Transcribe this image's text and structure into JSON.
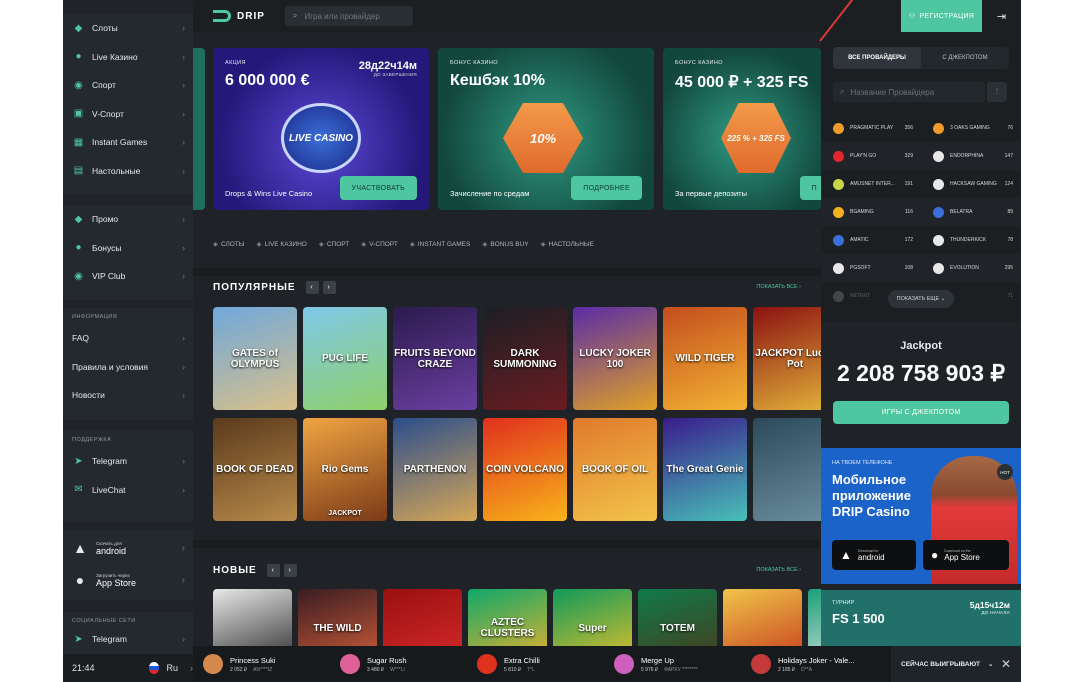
{
  "sidebar": {
    "main_items": [
      {
        "label": "Слоты",
        "icon": "slots-icon"
      },
      {
        "label": "Live Казино",
        "icon": "live-casino-icon"
      },
      {
        "label": "Спорт",
        "icon": "sport-icon"
      },
      {
        "label": "V-Спорт",
        "icon": "vsport-icon"
      },
      {
        "label": "Instant Games",
        "icon": "instant-games-icon"
      },
      {
        "label": "Настольные",
        "icon": "table-games-icon"
      }
    ],
    "promo_items": [
      {
        "label": "Промо",
        "icon": "promo-icon"
      },
      {
        "label": "Бонусы",
        "icon": "bonus-icon"
      },
      {
        "label": "VIP Club",
        "icon": "vip-icon"
      }
    ],
    "info_header": "ИНФОРМАЦИЯ",
    "info_items": [
      {
        "label": "FAQ"
      },
      {
        "label": "Правила и условия"
      },
      {
        "label": "Новости"
      }
    ],
    "support_header": "ПОДДЕРЖКА",
    "support_items": [
      {
        "label": "Telegram"
      },
      {
        "label": "LiveChat"
      }
    ],
    "android": {
      "small": "Скачать для",
      "big": "android"
    },
    "appstore": {
      "small": "Загрузить через",
      "big": "App Store"
    },
    "social_header": "СОЦИАЛЬНЫЕ СЕТИ",
    "social_item": "Telegram",
    "time": "21:44",
    "lang": "Ru"
  },
  "topbar": {
    "logo": "DRIP",
    "search_placeholder": "Игра или провайдер",
    "register": "РЕГИСТРАЦИЯ"
  },
  "banners": [
    {
      "label": "АКЦИЯ",
      "title": "6 000 000 €",
      "timer": "28д22ч14м",
      "timer_note": "ДО ЗАВЕРШЕНИЯ",
      "desc": "Drops & Wins Live Casino",
      "button": "УЧАСТВОВАТЬ",
      "badge": "LIVE CASINO",
      "color": "#3a2ea8"
    },
    {
      "label": "БОНУС КАЗИНО",
      "title": "Кешбэк 10%",
      "desc": "Зачисление по средам",
      "button": "ПОДРОБНЕЕ",
      "badge": "10%",
      "color": "#1e6f5f"
    },
    {
      "label": "БОНУС КАЗИНО",
      "title": "45 000 ₽ + 325 FS",
      "desc": "За первые депозиты",
      "button": "П",
      "badge": "225 % + 325 FS",
      "color": "#1e6f5f"
    }
  ],
  "categories": [
    "СЛОТЫ",
    "LIVE КАЗИНО",
    "СПОРТ",
    "V-СПОРТ",
    "INSTANT GAMES",
    "BONUS BUY",
    "НАСТОЛЬНЫЕ"
  ],
  "popular": {
    "title": "ПОПУЛЯРНЫЕ",
    "show_all": "ПОКАЗАТЬ ВСЕ",
    "games": [
      {
        "name": "GATES of OLYMPUS",
        "c1": "#6fa8dc",
        "c2": "#d9c089"
      },
      {
        "name": "PUG LIFE",
        "c1": "#7fc8e8",
        "c2": "#8ed06a"
      },
      {
        "name": "FRUITS BEYOND CRAZE",
        "c1": "#2c1b4f",
        "c2": "#6b3fa0"
      },
      {
        "name": "DARK SUMMONING",
        "c1": "#1c1f24",
        "c2": "#6a1c22"
      },
      {
        "name": "LUCKY JOKER 100",
        "c1": "#5a2ca6",
        "c2": "#e0a126"
      },
      {
        "name": "WILD TIGER",
        "c1": "#c44e1e",
        "c2": "#f2b233"
      },
      {
        "name": "JACKPOT Lucky Pot",
        "c1": "#8c1111",
        "c2": "#e2b43a"
      },
      {
        "name": "BOOK OF DEAD",
        "c1": "#5b3a1c",
        "c2": "#b88a4a"
      },
      {
        "name": "Rio Gems",
        "c1": "#f0a542",
        "c2": "#7b3a18"
      },
      {
        "name": "PARTHENON",
        "c1": "#2b4e8c",
        "c2": "#d6a656"
      },
      {
        "name": "COIN VOLCANO",
        "c1": "#e0301e",
        "c2": "#f8b31a"
      },
      {
        "name": "BOOK OF OIL",
        "c1": "#e07a2c",
        "c2": "#f2c44a"
      },
      {
        "name": "The Great Genie",
        "c1": "#3a1c8c",
        "c2": "#48c0b8"
      },
      {
        "name": "",
        "c1": "#2c4a5a",
        "c2": "#6b8fa0"
      }
    ],
    "jackpot_tag": "JACKPOT"
  },
  "new_games": {
    "title": "НОВЫЕ",
    "show_all": "ПОКАЗАТЬ ВСЕ",
    "games": [
      {
        "name": "",
        "c1": "#e8e8e8",
        "c2": "#2a2a2a"
      },
      {
        "name": "THE WILD",
        "c1": "#3a1c22",
        "c2": "#d05e3a"
      },
      {
        "name": "",
        "c1": "#9a1010",
        "c2": "#d62a2a"
      },
      {
        "name": "AZTEC CLUSTERS",
        "c1": "#0fa86a",
        "c2": "#f0b12a"
      },
      {
        "name": "Super",
        "c1": "#0f9a5a",
        "c2": "#e8c02a"
      },
      {
        "name": "TOTEM",
        "c1": "#0f7a4a",
        "c2": "#4a3a1c"
      },
      {
        "name": "",
        "c1": "#f0c44a",
        "c2": "#c43a1c"
      },
      {
        "name": "",
        "c1": "#1aa078",
        "c2": "#e8e8e8"
      }
    ]
  },
  "providers": {
    "tab_all": "ВСЕ ПРОВАЙДЕРЫ",
    "tab_jackpot": "С ДЖЕКПОТОМ",
    "search_placeholder": "Название Провайдера",
    "show_more": "ПОКАЗАТЬ ЕЩЕ",
    "rows": [
      [
        {
          "name": "PRAGMATIC PLAY",
          "count": "356",
          "color": "#f29a2a"
        },
        {
          "name": "3 OAKS GAMING",
          "count": "76",
          "color": "#f29a2a"
        }
      ],
      [
        {
          "name": "PLAY'N GO",
          "count": "329",
          "color": "#e2262c"
        },
        {
          "name": "ENDORPHINA",
          "count": "147",
          "color": "#e8e8e8"
        }
      ],
      [
        {
          "name": "AMUSNET INTER...",
          "count": "191",
          "color": "#c9d64a"
        },
        {
          "name": "HACKSAW GAMING",
          "count": "124",
          "color": "#e8e8e8"
        }
      ],
      [
        {
          "name": "BGAMING",
          "count": "116",
          "color": "#f2b21e"
        },
        {
          "name": "BELATRA",
          "count": "89",
          "color": "#3a6fd8"
        }
      ],
      [
        {
          "name": "AMATIC",
          "count": "172",
          "color": "#3a6fd8"
        },
        {
          "name": "THUNDERKICK",
          "count": "78",
          "color": "#e8e8e8"
        }
      ],
      [
        {
          "name": "PGSOFT",
          "count": "108",
          "color": "#e8e8e8"
        },
        {
          "name": "EVOLUTION",
          "count": "295",
          "color": "#e8e8e8"
        }
      ],
      [
        {
          "name": "NETENT",
          "count": "",
          "color": "#8a9096"
        },
        {
          "name": "",
          "count": "71",
          "color": "#8a9096"
        }
      ]
    ]
  },
  "jackpot": {
    "title": "Jackpot",
    "value": "2 208 758 903 ₽",
    "button": "ИГРЫ С ДЖЕКПОТОМ"
  },
  "mobile_promo": {
    "label": "НА ТВОЕМ ТЕЛЕФОНЕ",
    "line1": "Мобильное",
    "line2": "приложение",
    "line3": "DRIP Casino",
    "hot": "HOT",
    "android_small": "Download for",
    "android_big": "android",
    "ios_small": "Download on the",
    "ios_big": "App Store"
  },
  "tournament": {
    "label": "ТУРНИР",
    "title": "FS 1 500",
    "timer": "5д15ч12м",
    "timer_note": "ДО НАЧАЛА"
  },
  "ticker": {
    "items": [
      {
        "game": "Princess Suki",
        "amount": "2 052 ₽",
        "user": "AN****IZ",
        "color": "#d4884a"
      },
      {
        "game": "Sugar Rush",
        "amount": "3 480 ₽",
        "user": "W***LI",
        "color": "#e0609a"
      },
      {
        "game": "Extra Chilli",
        "amount": "5 810 ₽",
        "user": "T*L",
        "color": "#e0301e"
      },
      {
        "game": "Merge Up",
        "amount": "5 976 ₽",
        "user": "ФАРХУ ********",
        "color": "#d060c0"
      },
      {
        "game": "Holidays Joker - Vale...",
        "amount": "2 185 ₽",
        "user": "D**A",
        "color": "#c43a3a"
      }
    ],
    "winners_label": "СЕЙЧАС ВЫИГРЫВАЮТ"
  }
}
